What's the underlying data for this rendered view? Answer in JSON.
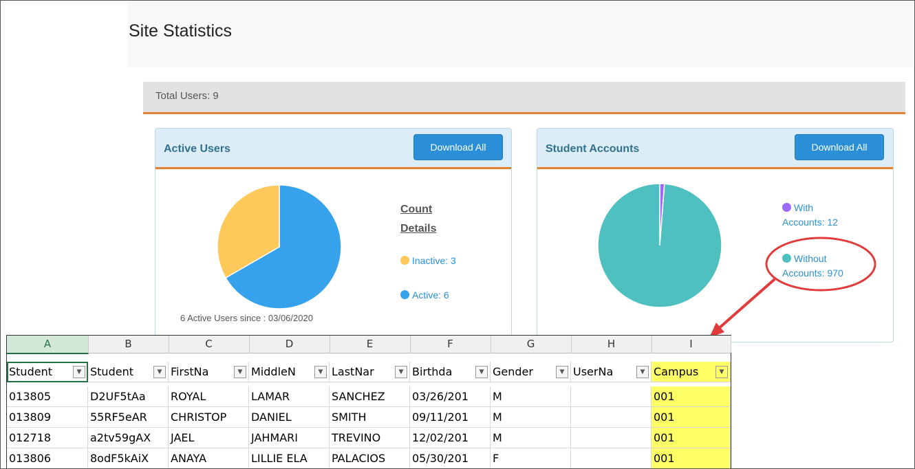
{
  "page": {
    "title": "Site Statistics"
  },
  "total": {
    "label": "Total Users: 9"
  },
  "active_panel": {
    "title": "Active Users",
    "download_label": "Download All",
    "legend_heading_1": "Count",
    "legend_heading_2": "Details",
    "inactive": "Inactive: 3",
    "active": "Active: 6",
    "caption": "6 Active Users since : 03/06/2020"
  },
  "student_panel": {
    "title": "Student Accounts",
    "download_label": "Download All",
    "with_1": "With",
    "with_2": "Accounts: 12",
    "without_1": "Without",
    "without_2": "Accounts: 970"
  },
  "chart_data": [
    {
      "type": "pie",
      "title": "Active Users",
      "categories": [
        "Inactive",
        "Active"
      ],
      "values": [
        3,
        6
      ],
      "colors": [
        "#fec85a",
        "#36a2eb"
      ]
    },
    {
      "type": "pie",
      "title": "Student Accounts",
      "categories": [
        "With Accounts",
        "Without Accounts"
      ],
      "values": [
        12,
        970
      ],
      "colors": [
        "#9c6af5",
        "#4fc0c0"
      ]
    }
  ],
  "spreadsheet": {
    "columns": [
      "A",
      "B",
      "C",
      "D",
      "E",
      "F",
      "G",
      "H",
      "I"
    ],
    "selected_column": "A",
    "headers": [
      "Student",
      "Student",
      "FirstNa",
      "MiddleN",
      "LastNar",
      "Birthda",
      "Gender",
      "UserNa",
      "Campus"
    ],
    "rows": [
      [
        "013805",
        "D2UF5tAa",
        "ROYAL",
        "LAMAR",
        "SANCHEZ",
        "03/26/201",
        "M",
        "",
        "001"
      ],
      [
        "013809",
        "55RF5eAR",
        "CHRISTOP",
        "DANIEL",
        "SMITH",
        "09/11/201",
        "M",
        "",
        "001"
      ],
      [
        "012718",
        "a2tv59gAX",
        "JAEL",
        "JAHMARI",
        "TREVINO",
        "12/02/201",
        "M",
        "",
        "001"
      ],
      [
        "013806",
        "8odF5kAiX",
        "ANAYA",
        "LILLIE ELA",
        "PALACIOS",
        "05/30/201",
        "F",
        "",
        "001"
      ]
    ],
    "filter_icon": "filter-dropdown-icon",
    "highlight_color": "#ffff66"
  },
  "annotation": {
    "color": "#e23b3b"
  }
}
